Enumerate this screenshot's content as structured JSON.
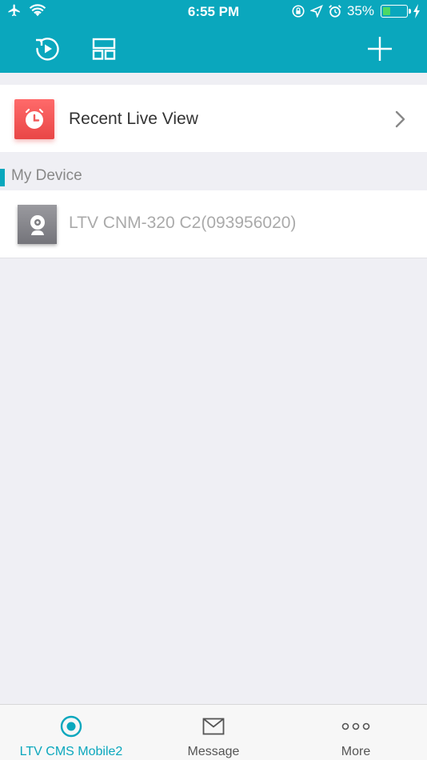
{
  "status_bar": {
    "time": "6:55 PM",
    "battery_text": "35%",
    "battery_level": 0.35,
    "icons": [
      "airplane-icon",
      "wifi-icon",
      "rotation-lock-icon",
      "location-icon",
      "alarm-icon",
      "battery-icon",
      "charging-icon"
    ]
  },
  "nav_bar": {
    "icons": [
      "playback-icon",
      "layout-grid-icon",
      "plus-icon"
    ]
  },
  "recent": {
    "label": "Recent Live View",
    "icon": "clock-icon",
    "chevron": "chevron-right-icon"
  },
  "section": {
    "title": "My Device"
  },
  "devices": [
    {
      "name": "LTV CNM-320 C2(093956020)",
      "icon": "webcam-icon"
    }
  ],
  "tabs": [
    {
      "label": "LTV CMS Mobile2",
      "icon": "live-icon",
      "active": true
    },
    {
      "label": "Message",
      "icon": "envelope-icon",
      "active": false
    },
    {
      "label": "More",
      "icon": "more-dots-icon",
      "active": false
    }
  ],
  "colors": {
    "accent": "#0aa7bd",
    "recent_icon_bg": "#f05a5a",
    "device_icon_bg": "#87878c",
    "background": "#efeff4"
  }
}
